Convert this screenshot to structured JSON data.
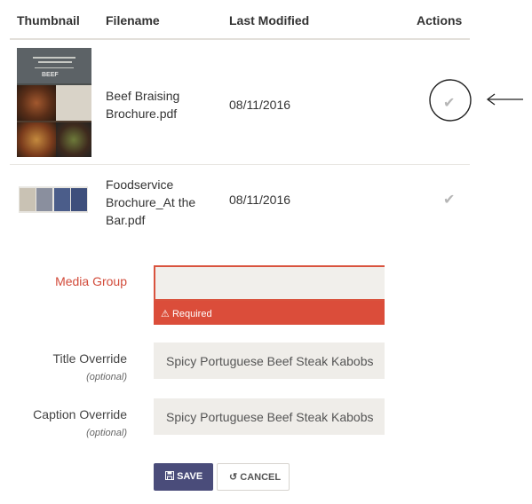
{
  "table": {
    "headers": {
      "thumbnail": "Thumbnail",
      "filename": "Filename",
      "last_modified": "Last Modified",
      "actions": "Actions"
    },
    "rows": [
      {
        "filename_lines": [
          "Beef Braising",
          "Brochure.pdf"
        ],
        "last_modified": "08/11/2016",
        "action_icon": "check-icon",
        "thumb_text": "BEEF"
      },
      {
        "filename_lines": [
          "Foodservice",
          "Brochure_At the",
          "Bar.pdf"
        ],
        "last_modified": "08/11/2016",
        "action_icon": "check-icon"
      }
    ]
  },
  "form": {
    "media_group": {
      "label": "Media Group",
      "value": "",
      "error": "Required"
    },
    "title_override": {
      "label": "Title Override",
      "optional": "(optional)",
      "value": "Spicy Portuguese Beef Steak Kabobs"
    },
    "caption_override": {
      "label": "Caption Override",
      "optional": "(optional)",
      "value": "Spicy Portuguese Beef Steak Kabobs"
    },
    "save_label": "SAVE",
    "cancel_label": "CANCEL"
  },
  "icons": {
    "check": "✔",
    "warning": "⚠",
    "undo": "↺"
  },
  "colors": {
    "error": "#d9533e",
    "save_button": "#4a4c7a",
    "field_bg": "#efede9"
  }
}
